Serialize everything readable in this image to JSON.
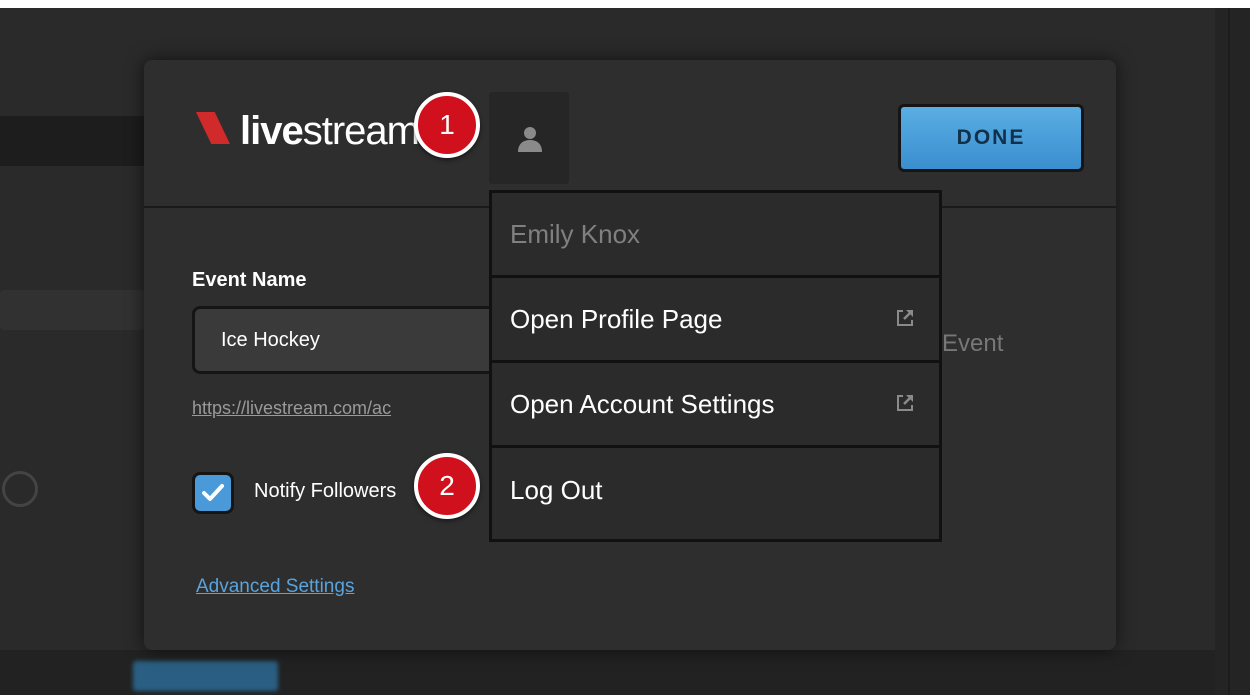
{
  "app": {
    "logo_text_bold": "live",
    "logo_text_regular": "stream"
  },
  "header": {
    "done_label": "DONE"
  },
  "form": {
    "event_name_label": "Event Name",
    "event_name_value": "Ice Hockey",
    "url_text": "https://livestream.com/ac",
    "event_suffix": "Event",
    "notify_label": "Notify Followers",
    "notify_checked": true,
    "advanced_label": "Advanced Settings"
  },
  "profile_menu": {
    "user_name": "Emily Knox",
    "items": [
      {
        "label": "Open Profile Page",
        "icon": "external-link-icon"
      },
      {
        "label": "Open Account Settings",
        "icon": "external-link-icon"
      },
      {
        "label": "Log Out"
      }
    ]
  },
  "annotations": {
    "marker_1": "1",
    "marker_2": "2"
  },
  "colors": {
    "accent_blue": "#3b8ecf",
    "logo_red": "#d12a2a",
    "marker_red": "#d0101c",
    "link_blue": "#5aa3dc"
  }
}
